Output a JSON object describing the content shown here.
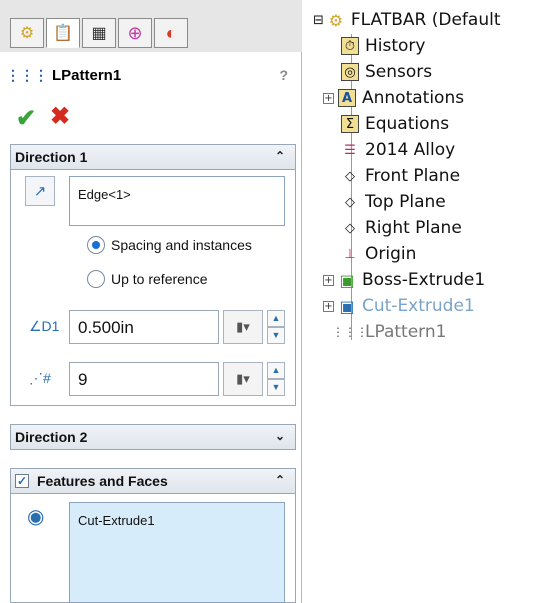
{
  "tabs": [
    {
      "name": "feature-manager-tab",
      "icon": "⚙"
    },
    {
      "name": "property-manager-tab",
      "icon": "📋"
    },
    {
      "name": "configuration-manager-tab",
      "icon": "▦"
    },
    {
      "name": "dimxpert-tab",
      "icon": "⊕"
    },
    {
      "name": "display-manager-tab",
      "icon": "◐"
    }
  ],
  "header": {
    "title": "LPattern1",
    "help": "?"
  },
  "actions": {
    "ok_label": "✔",
    "cancel_label": "✖"
  },
  "direction1": {
    "title": "Direction 1",
    "reference": "Edge<1>",
    "options": [
      {
        "label": "Spacing and instances",
        "selected": true
      },
      {
        "label": "Up to reference",
        "selected": false
      }
    ],
    "spacing": "0.500in",
    "instances": "9",
    "chevron": "⌃"
  },
  "direction2": {
    "title": "Direction 2",
    "chevron": "⌄"
  },
  "features": {
    "title": "Features and Faces",
    "checked": true,
    "item": "Cut-Extrude1",
    "chevron": "⌃"
  },
  "tree": {
    "root": "FLATBAR  (Default",
    "items": [
      {
        "label": "History"
      },
      {
        "label": "Sensors"
      },
      {
        "label": "Annotations"
      },
      {
        "label": "Equations"
      },
      {
        "label": "2014 Alloy"
      },
      {
        "label": "Front Plane"
      },
      {
        "label": "Top Plane"
      },
      {
        "label": "Right Plane"
      },
      {
        "label": "Origin"
      },
      {
        "label": "Boss-Extrude1"
      },
      {
        "label": "Cut-Extrude1"
      },
      {
        "label": "LPattern1"
      }
    ]
  }
}
